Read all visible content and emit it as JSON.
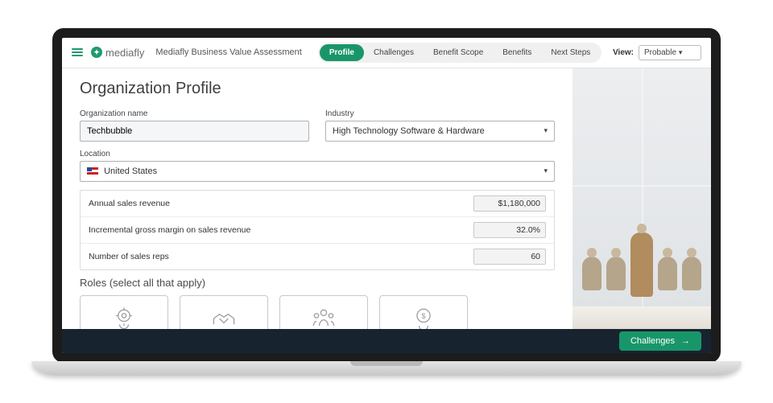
{
  "brand": "mediafly",
  "appTitle": "Mediafly Business Value Assessment",
  "tabs": [
    "Profile",
    "Challenges",
    "Benefit Scope",
    "Benefits",
    "Next Steps"
  ],
  "viewLabel": "View:",
  "viewValue": "Probable",
  "page": {
    "heading": "Organization Profile",
    "orgNameLabel": "Organization name",
    "orgNameValue": "Techbubble",
    "industryLabel": "Industry",
    "industryValue": "High Technology Software & Hardware",
    "locationLabel": "Location",
    "locationValue": "United States"
  },
  "metrics": [
    {
      "label": "Annual sales revenue",
      "value": "$1,180,000"
    },
    {
      "label": "Incremental gross margin on sales revenue",
      "value": "32.0%"
    },
    {
      "label": "Number of sales reps",
      "value": "60"
    }
  ],
  "rolesTitle": "Roles (select all that apply)",
  "footerButton": "Challenges"
}
